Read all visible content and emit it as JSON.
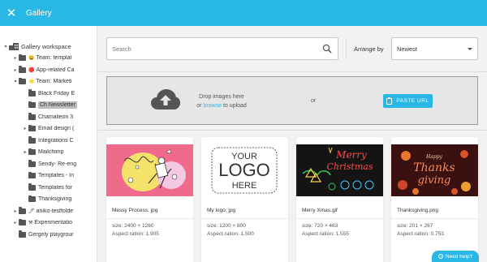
{
  "header": {
    "title": "Gallery",
    "close_icon": "close-icon"
  },
  "sidebar": {
    "root": {
      "label": "Gallery workspace"
    },
    "items": [
      {
        "label": "Team: templat",
        "emoji": "😀",
        "caret": "▸",
        "level": 1
      },
      {
        "label": "App-related Ca",
        "emoji": "🔴",
        "caret": "▸",
        "level": 1
      },
      {
        "label": "Team: Marketi",
        "emoji": "🌟",
        "caret": "▾",
        "level": 1
      },
      {
        "label": "Black Friday E",
        "caret": "",
        "level": 2
      },
      {
        "label": "Ch Newsletter",
        "caret": "",
        "level": 2,
        "selected": true
      },
      {
        "label": "Chamaileon 3",
        "caret": "",
        "level": 2
      },
      {
        "label": "Email design (",
        "caret": "▸",
        "level": 2
      },
      {
        "label": "Integrations C",
        "caret": "",
        "level": 2
      },
      {
        "label": "Mailchimp",
        "caret": "▸",
        "level": 2
      },
      {
        "label": "Sendy- Re-eng",
        "caret": "",
        "level": 2
      },
      {
        "label": "Templates - In",
        "caret": "",
        "level": 2
      },
      {
        "label": "Templates for",
        "caret": "",
        "level": 2
      },
      {
        "label": "Thanksgiving",
        "caret": "",
        "level": 2
      },
      {
        "label": "aniko-testfolde",
        "emoji": "🖊",
        "caret": "▸",
        "level": 1
      },
      {
        "label": "Experimentatio",
        "emoji": "⚒",
        "caret": "▸",
        "level": 1
      },
      {
        "label": "Gergely playgrour",
        "caret": "",
        "level": 1
      }
    ]
  },
  "search": {
    "placeholder": "Search"
  },
  "arrange": {
    "label": "Arrange by",
    "value": "Newest"
  },
  "drop": {
    "line1": "Drop images here",
    "or_prefix": "or ",
    "browse": "browse",
    "to_upload": " to upload",
    "or": "or",
    "paste_button": "PASTE URL"
  },
  "cards": [
    {
      "name": "Messy Process. jpg",
      "size": "size: 2400 × 1260",
      "ratio": "Aspect ration: 1.905"
    },
    {
      "name": "My logo. jpg",
      "size": "size: 1200 × 800",
      "ratio": "Aspect ration: 1.500",
      "logo_text": [
        "YOUR",
        "LOGO",
        "HERE"
      ]
    },
    {
      "name": "Merry Xmas.gif",
      "size": "size: 720 × 463",
      "ratio": "Aspect ration: 1.555",
      "art_text": [
        "Merry",
        "Christmas"
      ]
    },
    {
      "name": "Thanksgiving.png",
      "size": "size: 201 × 267",
      "ratio": "Aspect ration: 0.753",
      "art_text": [
        "Happy",
        "Thanks",
        "giving"
      ]
    }
  ],
  "help": {
    "label": "Need help?"
  },
  "colors": {
    "accent": "#29b7e6",
    "sidebar_bg": "#ffffff",
    "main_bg": "#f2f2f2"
  }
}
